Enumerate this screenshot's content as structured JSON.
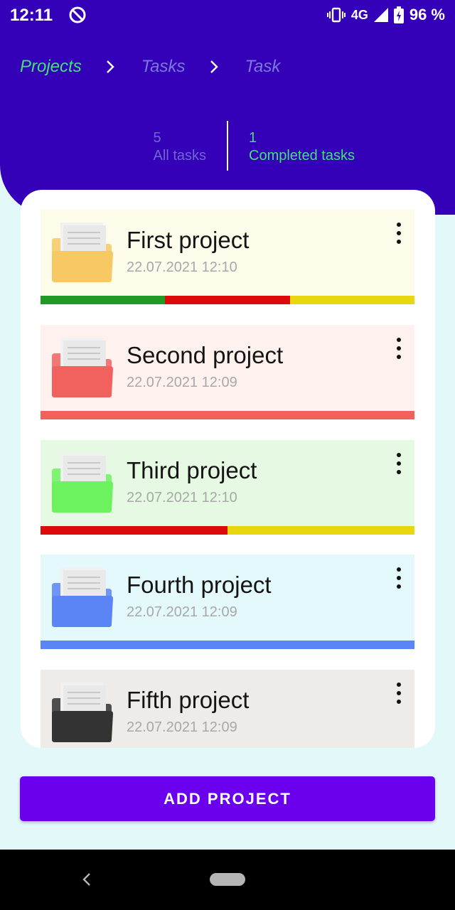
{
  "status": {
    "time": "12:11",
    "network": "4G",
    "battery": "96 %"
  },
  "breadcrumb": {
    "items": [
      "Projects",
      "Tasks",
      "Task"
    ]
  },
  "stats": {
    "all_count": "5",
    "all_label": "All tasks",
    "completed_count": "1",
    "completed_label": "Completed tasks"
  },
  "projects": [
    {
      "title": "First project",
      "date": "22.07.2021 12:10",
      "bg": "#fdfbea",
      "folder": "#f6c965",
      "bar": [
        {
          "color": "#1f9a25",
          "fraction": 0.3333
        },
        {
          "color": "#dc0a0a",
          "fraction": 0.3333
        },
        {
          "color": "#e8d60e",
          "fraction": 0.3334
        }
      ]
    },
    {
      "title": "Second project",
      "date": "22.07.2021 12:09",
      "bg": "#fff2ee",
      "folder": "#f1625f",
      "bar": [
        {
          "color": "#f1625f",
          "fraction": 1
        }
      ]
    },
    {
      "title": "Third project",
      "date": "22.07.2021 12:10",
      "bg": "#e6fae3",
      "folder": "#6cf25f",
      "bar": [
        {
          "color": "#dc0a0a",
          "fraction": 0.5
        },
        {
          "color": "#e8d60e",
          "fraction": 0.5
        }
      ]
    },
    {
      "title": "Fourth project",
      "date": "22.07.2021 12:09",
      "bg": "#e4f9fb",
      "folder": "#5b84f5",
      "bar": [
        {
          "color": "#5b84f5",
          "fraction": 1
        }
      ]
    },
    {
      "title": "Fifth project",
      "date": "22.07.2021 12:09",
      "bg": "#eeebe8",
      "folder": "#333333",
      "bar": []
    }
  ],
  "actions": {
    "add_project": "ADD PROJECT"
  },
  "colors": {
    "header": "#3400b8",
    "accent_green": "#45e07d",
    "button": "#6a00ee"
  }
}
